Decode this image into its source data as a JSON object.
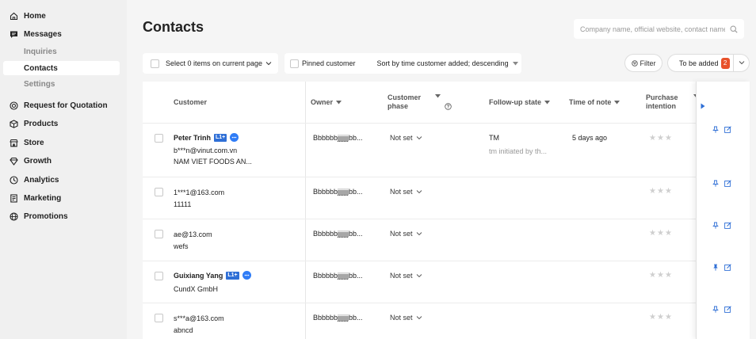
{
  "sidebar": {
    "items": [
      {
        "label": "Home",
        "icon": "home-icon"
      },
      {
        "label": "Messages",
        "icon": "message-icon"
      },
      {
        "label": "Request for Quotation",
        "icon": "rfq-icon"
      },
      {
        "label": "Products",
        "icon": "box-icon"
      },
      {
        "label": "Store",
        "icon": "store-icon"
      },
      {
        "label": "Growth",
        "icon": "diamond-icon"
      },
      {
        "label": "Analytics",
        "icon": "clock-icon"
      },
      {
        "label": "Marketing",
        "icon": "document-icon"
      },
      {
        "label": "Promotions",
        "icon": "globe-icon"
      }
    ],
    "messages_sub": [
      "Inquiries",
      "Contacts",
      "Settings"
    ]
  },
  "page": {
    "title": "Contacts"
  },
  "search": {
    "placeholder": "Company name, official website, contact name"
  },
  "toolbar": {
    "select_label": "Select 0 items on current page",
    "pinned_label": "Pinned customer",
    "sort_label": "Sort by time customer added; descending",
    "filter_label": "Filter",
    "to_be_added_label": "To be added",
    "to_be_added_count": "2"
  },
  "table": {
    "headers": {
      "customer": "Customer",
      "owner": "Owner",
      "phase_line1": "Customer",
      "phase_line2": "phase",
      "followup": "Follow-up state",
      "time": "Time of note",
      "intention_line1": "Purchase",
      "intention_line2": "intention"
    },
    "rows": [
      {
        "name": "Peter Trinh",
        "tag": "L1+",
        "email": "b***n@vinut.com.vn",
        "company": "NAM VIET FOODS AN...",
        "owner": "Bbbbbbjjjjjjjbb...",
        "phase": "Not set",
        "followup": "TM",
        "followup_sub": "tm initiated by th...",
        "time": "5 days ago",
        "pinned": false
      },
      {
        "email": "1***1@163.com",
        "company": "11111",
        "owner": "Bbbbbbjjjjjjjbb...",
        "phase": "Not set",
        "pinned": false
      },
      {
        "email": "ae@13.com",
        "company": "wefs",
        "owner": "Bbbbbbjjjjjjjbb...",
        "phase": "Not set",
        "pinned": false
      },
      {
        "name": "Guixiang Yang",
        "tag": "L1+",
        "company": "CundX GmbH",
        "owner": "Bbbbbbjjjjjjjbb...",
        "phase": "Not set",
        "pinned": true
      },
      {
        "email": "s***a@163.com",
        "company": "abncd",
        "owner": "Bbbbbbjjjjjjjbb...",
        "phase": "Not set",
        "pinned": false
      }
    ]
  },
  "colors": {
    "accent_blue": "#2f6fd6",
    "badge_orange": "#e8512a",
    "sidebar_active_bg": "#ffffff"
  }
}
